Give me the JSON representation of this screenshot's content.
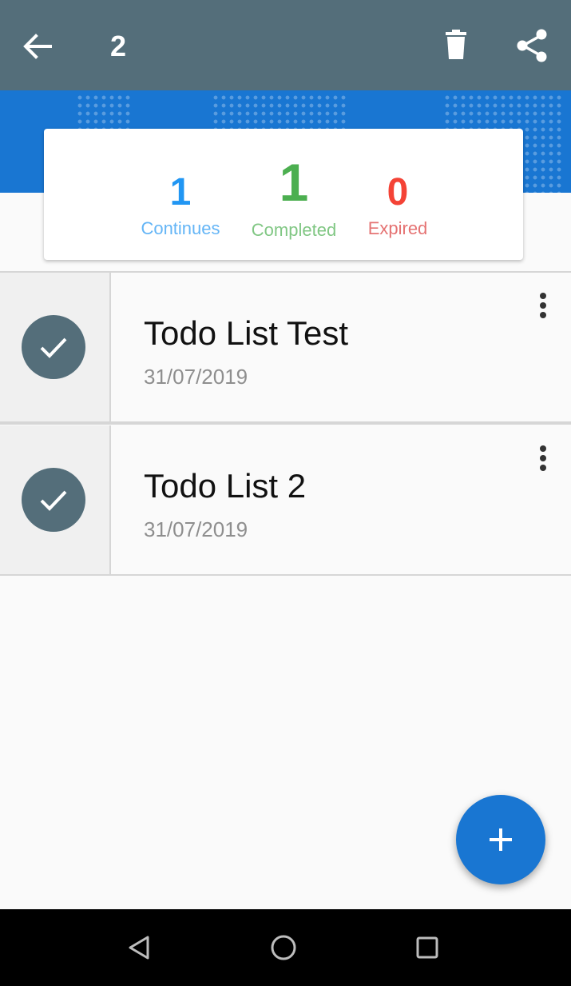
{
  "appbar": {
    "title": "2",
    "back_icon": "arrow-back-icon",
    "delete_icon": "trash-icon",
    "share_icon": "share-icon",
    "background": "#546e7a"
  },
  "stats": {
    "continues": {
      "value": "1",
      "label": "Continues",
      "color": "#2196f3"
    },
    "completed": {
      "value": "1",
      "label": "Completed",
      "color": "#4caf50"
    },
    "expired": {
      "value": "0",
      "label": "Expired",
      "color": "#f44336"
    }
  },
  "todos": [
    {
      "title": "Todo List Test",
      "date": "31/07/2019",
      "status": "completed"
    },
    {
      "title": "Todo List 2",
      "date": "31/07/2019",
      "status": "completed"
    }
  ],
  "fab": {
    "icon": "plus-icon",
    "color": "#1976d2"
  },
  "system_nav": {
    "back": "triangle-back-icon",
    "home": "circle-home-icon",
    "recents": "square-recents-icon"
  }
}
